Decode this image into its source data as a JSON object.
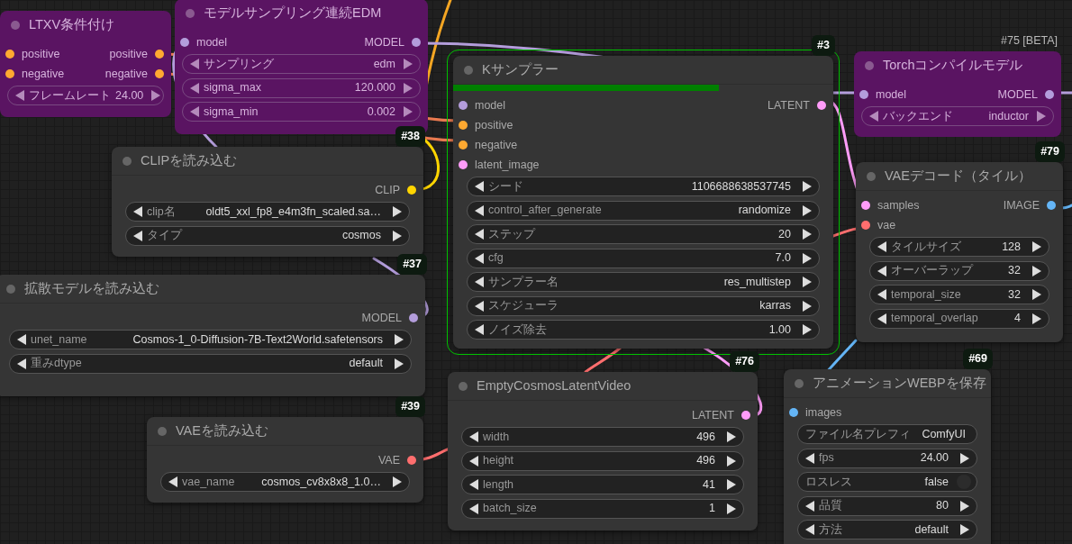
{
  "nodes": [
    {
      "title": "LTXV条件付け",
      "bypassed": true,
      "active": false,
      "inputs": [
        {
          "label": "positive",
          "color": "#ffa931"
        },
        {
          "label": "negative",
          "color": "#ffa931"
        }
      ],
      "outputs": [
        {
          "label": "positive",
          "color": "#ffa931"
        },
        {
          "label": "negative",
          "color": "#ffa931"
        }
      ],
      "widgets": [
        {
          "kind": "stepper",
          "label": "フレームレート",
          "value": "24.00"
        }
      ]
    },
    {
      "title": "モデルサンプリング連続EDM",
      "bypassed": true,
      "active": false,
      "inputs": [
        {
          "label": "model",
          "color": "#b39ddb"
        }
      ],
      "outputs": [
        {
          "label": "MODEL",
          "color": "#b39ddb"
        }
      ],
      "widgets": [
        {
          "kind": "stepper",
          "label": "サンプリング",
          "value": "edm"
        },
        {
          "kind": "stepper",
          "label": "sigma_max",
          "value": "120.000"
        },
        {
          "kind": "stepper",
          "label": "sigma_min",
          "value": "0.002"
        }
      ]
    },
    {
      "title": "Kサンプラー",
      "badge": "#3",
      "bypassed": false,
      "active": true,
      "level": 0.7,
      "inputs": [
        {
          "label": "model",
          "color": "#b39ddb"
        },
        {
          "label": "positive",
          "color": "#ffa931"
        },
        {
          "label": "negative",
          "color": "#ffa931"
        },
        {
          "label": "latent_image",
          "color": "#ff9cf9"
        }
      ],
      "outputs": [
        {
          "label": "LATENT",
          "color": "#ff9cf9"
        }
      ],
      "widgets": [
        {
          "kind": "stepper",
          "label": "シード",
          "value": "1106688638537745"
        },
        {
          "kind": "stepper",
          "label": "control_after_generate",
          "value": "randomize"
        },
        {
          "kind": "stepper",
          "label": "ステップ",
          "value": "20"
        },
        {
          "kind": "stepper",
          "label": "cfg",
          "value": "7.0"
        },
        {
          "kind": "stepper",
          "label": "サンプラー名",
          "value": "res_multistep"
        },
        {
          "kind": "stepper",
          "label": "スケジューラ",
          "value": "karras"
        },
        {
          "kind": "stepper",
          "label": "ノイズ除去",
          "value": "1.00"
        }
      ]
    },
    {
      "title": "Torchコンパイルモデル",
      "badge": "#75 [BETA]",
      "bypassed": true,
      "active": false,
      "inputs": [
        {
          "label": "model",
          "color": "#b39ddb"
        }
      ],
      "outputs": [
        {
          "label": "MODEL",
          "color": "#b39ddb"
        }
      ],
      "widgets": [
        {
          "kind": "stepper",
          "label": "バックエンド",
          "value": "inductor"
        }
      ]
    },
    {
      "title": "CLIPを読み込む",
      "badge": "#38",
      "bypassed": false,
      "active": false,
      "outputs": [
        {
          "label": "CLIP",
          "color": "#ffd500"
        }
      ],
      "widgets": [
        {
          "kind": "stepper",
          "label": "clip名",
          "value": "oldt5_xxl_fp8_e4m3fn_scaled.sa…"
        },
        {
          "kind": "stepper",
          "label": "タイプ",
          "value": "cosmos"
        }
      ]
    },
    {
      "title": "VAEデコード（タイル）",
      "badge": "#79",
      "bypassed": false,
      "active": false,
      "inputs": [
        {
          "label": "samples",
          "color": "#ff9cf9"
        },
        {
          "label": "vae",
          "color": "#ff6e6e"
        }
      ],
      "outputs": [
        {
          "label": "IMAGE",
          "color": "#64b5f6"
        }
      ],
      "widgets": [
        {
          "kind": "stepper",
          "label": "タイルサイズ",
          "value": "128"
        },
        {
          "kind": "stepper",
          "label": "オーバーラップ",
          "value": "32"
        },
        {
          "kind": "stepper",
          "label": "temporal_size",
          "value": "32"
        },
        {
          "kind": "stepper",
          "label": "temporal_overlap",
          "value": "4"
        }
      ]
    },
    {
      "title": "拡散モデルを読み込む",
      "badge": "#37",
      "bypassed": false,
      "active": false,
      "outputs": [
        {
          "label": "MODEL",
          "color": "#b39ddb"
        }
      ],
      "widgets": [
        {
          "kind": "stepper",
          "label": "unet_name",
          "value": "Cosmos-1_0-Diffusion-7B-Text2World.safetensors"
        },
        {
          "kind": "stepper",
          "label": "重みdtype",
          "value": "default"
        }
      ]
    },
    {
      "title": "VAEを読み込む",
      "badge": "#39",
      "bypassed": false,
      "active": false,
      "outputs": [
        {
          "label": "VAE",
          "color": "#ff6e6e"
        }
      ],
      "widgets": [
        {
          "kind": "stepper",
          "label": "vae_name",
          "value": "cosmos_cv8x8x8_1.0…"
        }
      ]
    },
    {
      "title": "EmptyCosmosLatentVideo",
      "badge": "#76",
      "bypassed": false,
      "active": false,
      "outputs": [
        {
          "label": "LATENT",
          "color": "#ff9cf9"
        }
      ],
      "widgets": [
        {
          "kind": "stepper",
          "label": "width",
          "value": "496"
        },
        {
          "kind": "stepper",
          "label": "height",
          "value": "496"
        },
        {
          "kind": "stepper",
          "label": "length",
          "value": "41"
        },
        {
          "kind": "stepper",
          "label": "batch_size",
          "value": "1"
        }
      ]
    },
    {
      "title": "アニメーションWEBPを保存",
      "badge": "#69",
      "bypassed": false,
      "active": false,
      "inputs": [
        {
          "label": "images",
          "color": "#64b5f6"
        }
      ],
      "widgets": [
        {
          "kind": "text",
          "label": "ファイル名プレフィ",
          "value": "ComfyUI"
        },
        {
          "kind": "stepper",
          "label": "fps",
          "value": "24.00"
        },
        {
          "kind": "toggle",
          "label": "ロスレス",
          "value": "false",
          "on": false
        },
        {
          "kind": "stepper",
          "label": "品質",
          "value": "80"
        },
        {
          "kind": "stepper",
          "label": "方法",
          "value": "default"
        }
      ]
    }
  ]
}
